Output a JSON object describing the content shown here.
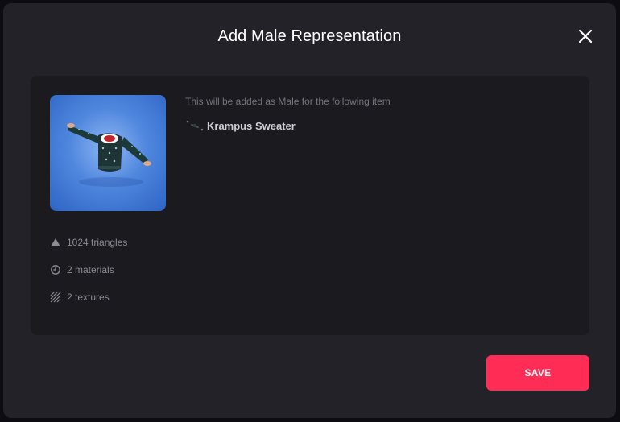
{
  "modal": {
    "title": "Add Male Representation",
    "close_icon": "close-icon"
  },
  "preview": {
    "alt_icon": "sweater-3d-preview"
  },
  "stats": {
    "triangles": "1024 triangles",
    "materials": "2 materials",
    "textures": "2 textures",
    "icons": [
      "triangle-icon",
      "clock-icon",
      "texture-hatch-icon"
    ]
  },
  "info": {
    "description": "This will be added as Male for the following item",
    "item_name": "Krampus Sweater"
  },
  "actions": {
    "save_label": "SAVE"
  },
  "colors": {
    "accent": "#ff2d55",
    "modal_bg": "#242229",
    "panel_bg": "#1b1a1f",
    "thumb_blue": "#4f87de"
  }
}
